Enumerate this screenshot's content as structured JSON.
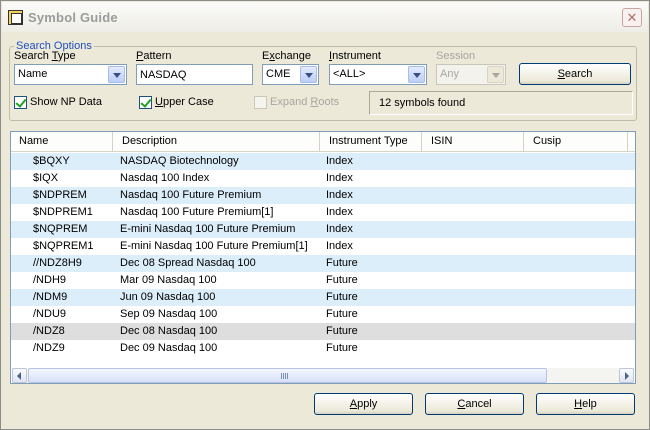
{
  "window": {
    "title": "Symbol Guide"
  },
  "search_options": {
    "legend": "Search Options",
    "search_type": {
      "label_pre": "Search ",
      "label_ul": "T",
      "label_post": "ype",
      "value": "Name"
    },
    "pattern": {
      "label_pre": "",
      "label_ul": "P",
      "label_post": "attern",
      "value": "NASDAQ"
    },
    "exchange": {
      "label_pre": "E",
      "label_ul": "x",
      "label_post": "change",
      "value": "CME"
    },
    "instrument": {
      "label_pre": "",
      "label_ul": "I",
      "label_post": "nstrument",
      "value": "<ALL>"
    },
    "session": {
      "label": "Session",
      "value": "Any"
    },
    "search_button": {
      "label_pre": "",
      "label_ul": "S",
      "label_post": "earch"
    },
    "show_np_data": {
      "label": "Show NP Data",
      "checked": true
    },
    "upper_case": {
      "label_pre": "",
      "label_ul": "U",
      "label_post": "pper Case",
      "checked": true
    },
    "expand_roots": {
      "label_pre": "Expand ",
      "label_ul": "R",
      "label_post": "oots",
      "checked": false
    },
    "status": "12 symbols found"
  },
  "table": {
    "columns": [
      "Name",
      "Description",
      "Instrument Type",
      "ISIN",
      "Cusip"
    ],
    "rows": [
      {
        "name": "$BQXY",
        "description": "NASDAQ Biotechnology",
        "type": "Index"
      },
      {
        "name": "$IQX",
        "description": "Nasdaq 100 Index",
        "type": "Index"
      },
      {
        "name": "$NDPREM",
        "description": "Nasdaq 100 Future Premium",
        "type": "Index"
      },
      {
        "name": "$NDPREM1",
        "description": "Nasdaq 100 Future Premium[1]",
        "type": "Index"
      },
      {
        "name": "$NQPREM",
        "description": "E-mini Nasdaq 100 Future Premium",
        "type": "Index"
      },
      {
        "name": "$NQPREM1",
        "description": "E-mini Nasdaq 100 Future Premium[1]",
        "type": "Index"
      },
      {
        "name": "//NDZ8H9",
        "description": "Dec 08 Spread Nasdaq 100",
        "type": "Future"
      },
      {
        "name": "/NDH9",
        "description": "Mar 09 Nasdaq 100",
        "type": "Future"
      },
      {
        "name": "/NDM9",
        "description": "Jun 09 Nasdaq 100",
        "type": "Future"
      },
      {
        "name": "/NDU9",
        "description": "Sep 09 Nasdaq 100",
        "type": "Future"
      },
      {
        "name": "/NDZ8",
        "description": "Dec 08 Nasdaq 100",
        "type": "Future"
      },
      {
        "name": "/NDZ9",
        "description": "Dec 09 Nasdaq 100",
        "type": "Future"
      }
    ]
  },
  "footer": {
    "apply": {
      "label_pre": "",
      "label_ul": "A",
      "label_post": "pply"
    },
    "cancel": {
      "label_pre": "",
      "label_ul": "C",
      "label_post": "ancel"
    },
    "help": {
      "label_pre": "",
      "label_ul": "H",
      "label_post": "elp"
    }
  },
  "colors": {
    "legend": "#1e4fbf",
    "alt_row": "#dceefa",
    "selected_row": "#dedede",
    "button_border": "#003c74"
  },
  "icons": {
    "app": "symbol-guide-icon",
    "close": "close-icon",
    "dropdown": "chevron-down-icon"
  }
}
